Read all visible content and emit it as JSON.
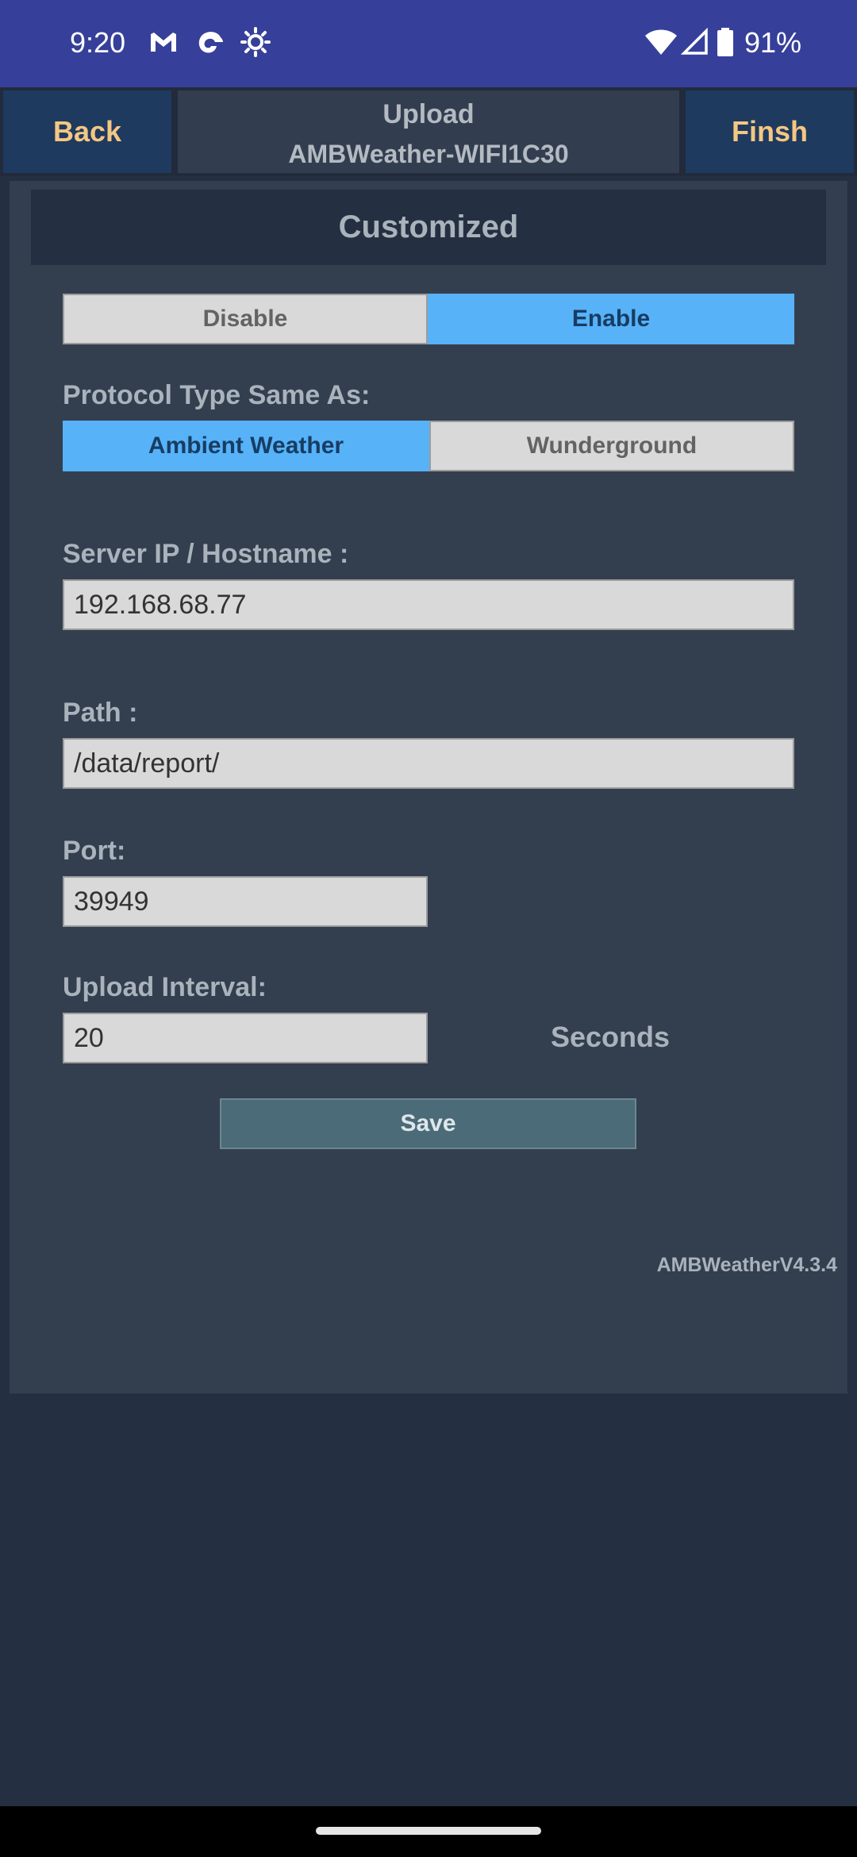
{
  "status_bar": {
    "time": "9:20",
    "battery": "91%",
    "icons": [
      "gmail-icon",
      "swirl-app-icon",
      "brightness-icon",
      "wifi-icon",
      "cell-signal-icon",
      "battery-icon"
    ]
  },
  "nav": {
    "back_label": "Back",
    "title_line1": "Upload",
    "title_line2": "AMBWeather-WIFI1C30",
    "finish_label": "Finsh"
  },
  "section": {
    "title": "Customized"
  },
  "enable_toggle": {
    "disable_label": "Disable",
    "enable_label": "Enable",
    "selected": "Enable"
  },
  "protocol": {
    "label": "Protocol Type Same As:",
    "ambient_label": "Ambient Weather",
    "wunderground_label": "Wunderground",
    "selected": "Ambient Weather"
  },
  "server": {
    "label": "Server IP / Hostname :",
    "value": "192.168.68.77"
  },
  "path": {
    "label": "Path :",
    "value": "/data/report/"
  },
  "port": {
    "label": "Port:",
    "value": "39949"
  },
  "interval": {
    "label": "Upload Interval:",
    "value": "20",
    "unit": "Seconds"
  },
  "save_label": "Save",
  "version": "AMBWeatherV4.3.4",
  "colors": {
    "status_bar": "#36409a",
    "accent_selected": "#57b2f8",
    "nav_button_text": "#f4c782",
    "panel": "#333f4f",
    "background": "#243042"
  }
}
